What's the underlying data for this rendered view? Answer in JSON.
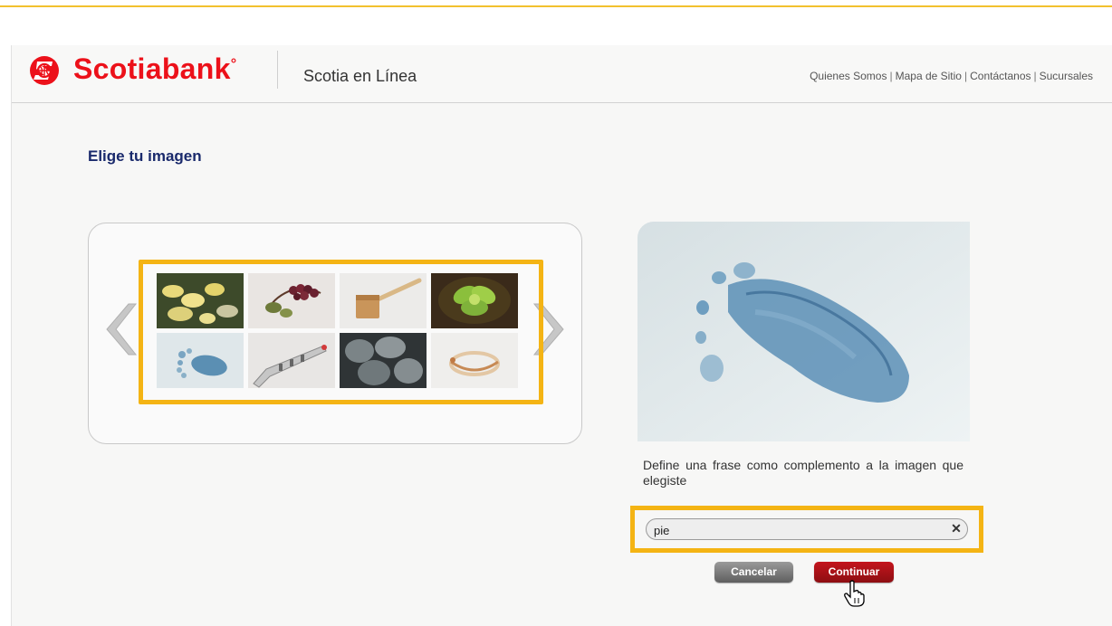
{
  "header": {
    "brand": "Scotiabank",
    "brand_mark": "°",
    "product": "Scotia en Línea",
    "nav": [
      "Quienes Somos",
      "Mapa de Sitio",
      "Contáctanos",
      "Sucursales"
    ],
    "separator": "|",
    "brand_color": "#ec111a"
  },
  "main": {
    "title": "Elige tu imagen",
    "gallery": {
      "thumbnails": [
        "flowers",
        "berries",
        "wooden-mallet",
        "succulent",
        "footprint",
        "toy-trumpet",
        "cactus",
        "bracelet"
      ],
      "selected": "footprint"
    },
    "caption": "Define una frase como complemento a la imagen que elegiste",
    "phrase_value": "pie",
    "clear_symbol": "✕",
    "buttons": {
      "cancel": "Cancelar",
      "continue": "Continuar"
    }
  },
  "colors": {
    "highlight": "#f4b414",
    "title": "#1a2a6c",
    "continue_button": "#a81218",
    "cancel_button": "#7a7a7a"
  }
}
